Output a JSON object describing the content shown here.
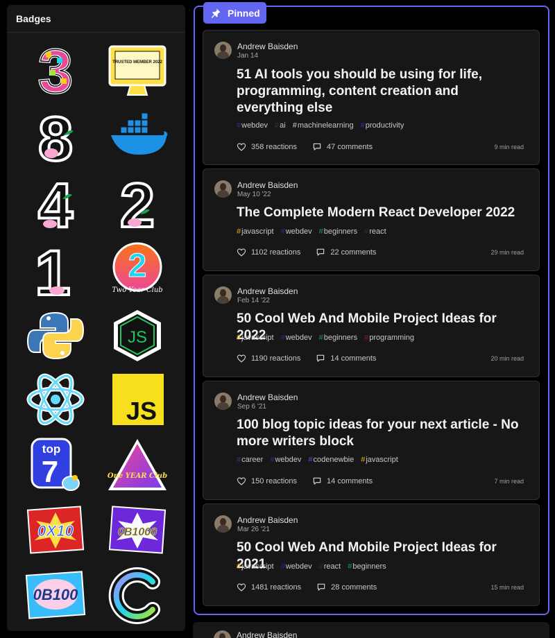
{
  "badges": {
    "title": "Badges",
    "items": [
      {
        "name": "three-year-club",
        "text": "3"
      },
      {
        "name": "trusted-member-2022",
        "text": "TRUSTED MEMBER 2022"
      },
      {
        "name": "eight-week-streak",
        "text": "8"
      },
      {
        "name": "docker",
        "text": ""
      },
      {
        "name": "four-week-streak",
        "text": "4"
      },
      {
        "name": "two-week-streak",
        "text": "2"
      },
      {
        "name": "one-week-streak",
        "text": "1"
      },
      {
        "name": "two-year-club",
        "text": "2",
        "subtext": "Two Year Club"
      },
      {
        "name": "python",
        "text": ""
      },
      {
        "name": "nodejs",
        "text": "JS"
      },
      {
        "name": "react",
        "text": ""
      },
      {
        "name": "javascript",
        "text": "JS"
      },
      {
        "name": "top-7",
        "text": "top",
        "subtext": "7"
      },
      {
        "name": "one-year-club",
        "text": "One YEAR Club"
      },
      {
        "name": "0x10",
        "text": "0X10"
      },
      {
        "name": "0b1000",
        "text": "0B1000"
      },
      {
        "name": "0b100",
        "text": "0B100"
      },
      {
        "name": "codenewbie",
        "text": "C"
      }
    ]
  },
  "pinned": {
    "label": "Pinned"
  },
  "posts": [
    {
      "author": "Andrew Baisden",
      "date": "Jan 14",
      "title": "51 AI tools you should be using for life, programming, content creation and everything else",
      "tags": [
        {
          "name": "webdev",
          "color": "#4c1d95"
        },
        {
          "name": "ai",
          "color": "#333333"
        },
        {
          "name": "machinelearning",
          "color": "#d0d0d0"
        },
        {
          "name": "productivity",
          "color": "#5b21b6"
        }
      ],
      "reactions": "358 reactions",
      "comments": "47 comments",
      "readtime": "9 min read"
    },
    {
      "author": "Andrew Baisden",
      "date": "May 10 '22",
      "title": "The Complete Modern React Developer 2022",
      "tags": [
        {
          "name": "javascript",
          "color": "#eab308"
        },
        {
          "name": "webdev",
          "color": "#4c1d95"
        },
        {
          "name": "beginners",
          "color": "#16a34a"
        },
        {
          "name": "react",
          "color": "#333333"
        }
      ],
      "reactions": "1102 reactions",
      "comments": "22 comments",
      "readtime": "29 min read"
    },
    {
      "author": "Andrew Baisden",
      "date": "Feb 14 '22",
      "title": "50 Cool Web And Mobile Project Ideas for 2022",
      "tags": [
        {
          "name": "javascript",
          "color": "#eab308"
        },
        {
          "name": "webdev",
          "color": "#4c1d95"
        },
        {
          "name": "beginners",
          "color": "#16a34a"
        },
        {
          "name": "programming",
          "color": "#991b1b"
        }
      ],
      "reactions": "1190 reactions",
      "comments": "14 comments",
      "readtime": "20 min read"
    },
    {
      "author": "Andrew Baisden",
      "date": "Sep 6 '21",
      "title": "100 blog topic ideas for your next article - No more writers block",
      "tags": [
        {
          "name": "career",
          "color": "#3b3b7a"
        },
        {
          "name": "webdev",
          "color": "#4c1d95"
        },
        {
          "name": "codenewbie",
          "color": "#7c3aed"
        },
        {
          "name": "javascript",
          "color": "#eab308"
        }
      ],
      "reactions": "150 reactions",
      "comments": "14 comments",
      "readtime": "7 min read"
    },
    {
      "author": "Andrew Baisden",
      "date": "Mar 26 '21",
      "title": "50 Cool Web And Mobile Project Ideas for 2021",
      "tags": [
        {
          "name": "javascript",
          "color": "#eab308"
        },
        {
          "name": "webdev",
          "color": "#4c1d95"
        },
        {
          "name": "react",
          "color": "#333333"
        },
        {
          "name": "beginners",
          "color": "#16a34a"
        }
      ],
      "reactions": "1481 reactions",
      "comments": "28 comments",
      "readtime": "15 min read"
    }
  ],
  "next_post": {
    "author": "Andrew Baisden"
  },
  "colors": {
    "accent": "#6366f1",
    "card": "#171717",
    "border": "#303030"
  }
}
